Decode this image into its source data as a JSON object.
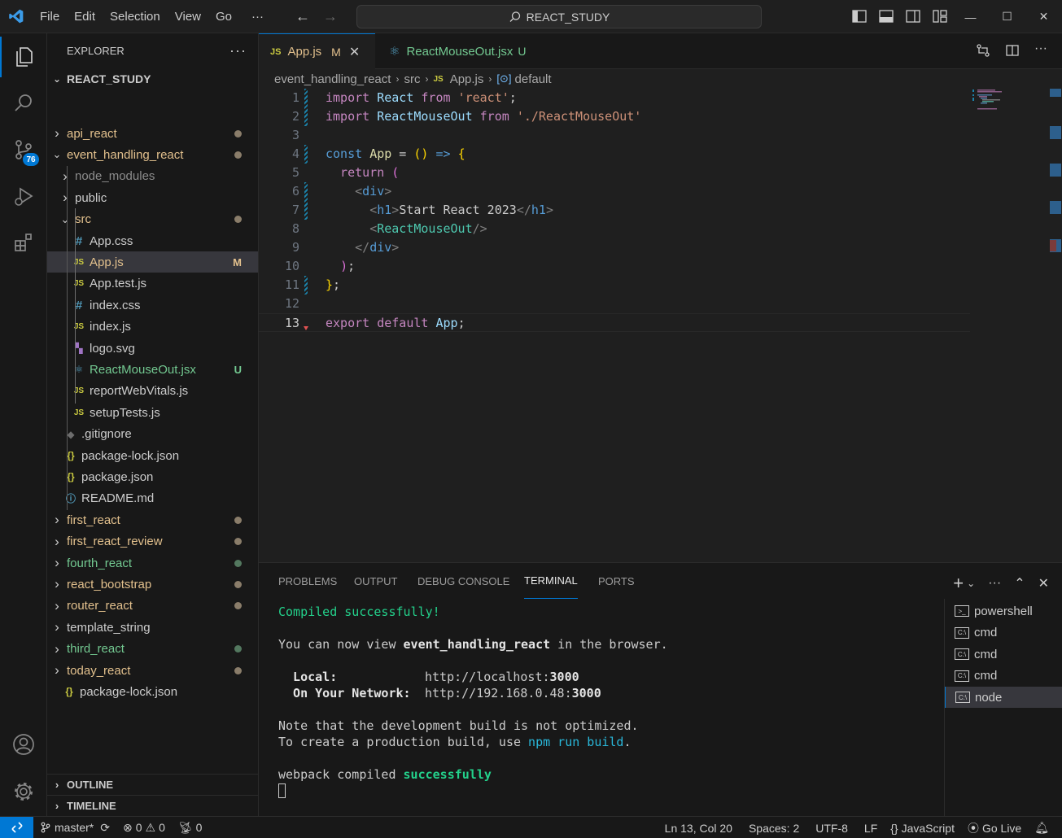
{
  "titlebar": {
    "menu": [
      "File",
      "Edit",
      "Selection",
      "View",
      "Go",
      "···"
    ],
    "search_text": "REACT_STUDY"
  },
  "activity": {
    "source_control_badge": "76"
  },
  "explorer": {
    "title": "EXPLORER",
    "more": "···",
    "root": "REACT_STUDY",
    "items": [
      {
        "label": "api_react",
        "icon": "",
        "status": "dot"
      },
      {
        "label": "event_handling_react",
        "icon": "",
        "status": "dot"
      },
      {
        "label": "node_modules",
        "icon": ""
      },
      {
        "label": "public",
        "icon": ""
      },
      {
        "label": "src",
        "icon": "",
        "status": "dot"
      },
      {
        "label": "App.css",
        "icon": "#"
      },
      {
        "label": "App.js",
        "icon": "JS",
        "status": "M"
      },
      {
        "label": "App.test.js",
        "icon": "JS"
      },
      {
        "label": "index.css",
        "icon": "#"
      },
      {
        "label": "index.js",
        "icon": "JS"
      },
      {
        "label": "logo.svg",
        "icon": "▚"
      },
      {
        "label": "ReactMouseOut.jsx",
        "icon": "⚛",
        "status": "U"
      },
      {
        "label": "reportWebVitals.js",
        "icon": "JS"
      },
      {
        "label": "setupTests.js",
        "icon": "JS"
      },
      {
        "label": ".gitignore",
        "icon": "◆"
      },
      {
        "label": "package-lock.json",
        "icon": "{}"
      },
      {
        "label": "package.json",
        "icon": "{}"
      },
      {
        "label": "README.md",
        "icon": "ⓘ"
      },
      {
        "label": "first_react",
        "icon": "",
        "status": "dot"
      },
      {
        "label": "first_react_review",
        "icon": "",
        "status": "dot"
      },
      {
        "label": "fourth_react",
        "icon": "",
        "status": "dot"
      },
      {
        "label": "react_bootstrap",
        "icon": "",
        "status": "dot"
      },
      {
        "label": "router_react",
        "icon": "",
        "status": "dot"
      },
      {
        "label": "template_string",
        "icon": ""
      },
      {
        "label": "third_react",
        "icon": "",
        "status": "dot"
      },
      {
        "label": "today_react",
        "icon": "",
        "status": "dot"
      },
      {
        "label": "package-lock.json",
        "icon": "{}"
      }
    ],
    "outline": "OUTLINE",
    "timeline": "TIMELINE"
  },
  "tabs": [
    {
      "icon": "JS",
      "label": "App.js",
      "status": "M",
      "close": "✕"
    },
    {
      "icon": "⚛",
      "label": "ReactMouseOut.jsx",
      "status": "U"
    }
  ],
  "breadcrumb": {
    "parts": [
      "event_handling_react",
      "src",
      "App.js",
      "default"
    ],
    "js_icon": "JS"
  },
  "code": {
    "line_numbers": [
      "1",
      "2",
      "3",
      "4",
      "5",
      "6",
      "7",
      "8",
      "9",
      "10",
      "11",
      "12",
      "13"
    ],
    "current_line": 13,
    "lines": [
      [
        [
          "import",
          "kw"
        ],
        [
          " ",
          ""
        ],
        [
          "React",
          "var"
        ],
        [
          " ",
          ""
        ],
        [
          "from",
          "kw"
        ],
        [
          " ",
          ""
        ],
        [
          "'react'",
          "str"
        ],
        [
          ";",
          "txt"
        ]
      ],
      [
        [
          "import",
          "kw"
        ],
        [
          " ",
          ""
        ],
        [
          "ReactMouseOut",
          "var"
        ],
        [
          " ",
          ""
        ],
        [
          "from",
          "kw"
        ],
        [
          " ",
          ""
        ],
        [
          "'./ReactMouseOut'",
          "str"
        ]
      ],
      [],
      [
        [
          "const",
          "kw2"
        ],
        [
          " ",
          ""
        ],
        [
          "App",
          "fn"
        ],
        [
          " = ",
          "txt"
        ],
        [
          "()",
          "p1"
        ],
        [
          " ",
          ""
        ],
        [
          "=>",
          "kw2"
        ],
        [
          " ",
          ""
        ],
        [
          "{",
          "p1"
        ]
      ],
      [
        [
          "  return",
          "kw"
        ],
        [
          " ",
          ""
        ],
        [
          "(",
          "p2"
        ]
      ],
      [
        [
          "    ",
          ""
        ],
        [
          "<",
          "tagp"
        ],
        [
          "div",
          "tag"
        ],
        [
          ">",
          "tagp"
        ]
      ],
      [
        [
          "      ",
          ""
        ],
        [
          "<",
          "tagp"
        ],
        [
          "h1",
          "tag"
        ],
        [
          ">",
          "tagp"
        ],
        [
          "Start React 2023",
          "txt"
        ],
        [
          "</",
          "tagp"
        ],
        [
          "h1",
          "tag"
        ],
        [
          ">",
          "tagp"
        ]
      ],
      [
        [
          "      ",
          ""
        ],
        [
          "<",
          "tagp"
        ],
        [
          "ReactMouseOut",
          "comp"
        ],
        [
          "/>",
          "tagp"
        ]
      ],
      [
        [
          "    ",
          ""
        ],
        [
          "</",
          "tagp"
        ],
        [
          "div",
          "tag"
        ],
        [
          ">",
          "tagp"
        ]
      ],
      [
        [
          "  ",
          ""
        ],
        [
          ")",
          "p2"
        ],
        [
          ";",
          "txt"
        ]
      ],
      [
        [
          "}",
          "p1"
        ],
        [
          ";",
          "txt"
        ]
      ],
      [],
      [
        [
          "export",
          "kw"
        ],
        [
          " ",
          ""
        ],
        [
          "default",
          "kw"
        ],
        [
          " ",
          ""
        ],
        [
          "App",
          "var"
        ],
        [
          ";",
          "txt"
        ]
      ]
    ]
  },
  "panel": {
    "tabs": [
      "PROBLEMS",
      "OUTPUT",
      "DEBUG CONSOLE",
      "TERMINAL",
      "PORTS"
    ],
    "active_tab": "TERMINAL",
    "terminal": {
      "l1": "Compiled successfully!",
      "l2a": "You can now view ",
      "l2b": "event_handling_react",
      "l2c": " in the browser.",
      "local_label": "  Local:",
      "local_url": "http://localhost:",
      "local_port": "3000",
      "net_label": "  On Your Network:",
      "net_url": "http://192.168.0.48:",
      "net_port": "3000",
      "note1": "Note that the development build is not optimized.",
      "note2a": "To create a production build, use ",
      "note2b": "npm run build",
      "note2c": ".",
      "webpack_a": "webpack compiled ",
      "webpack_b": "successfully"
    },
    "terminals": [
      "powershell",
      "cmd",
      "cmd",
      "cmd",
      "node"
    ]
  },
  "statusbar": {
    "branch": "master*",
    "errors": "0",
    "warnings": "0",
    "ports": "0",
    "position": "Ln 13, Col 20",
    "spaces": "Spaces: 2",
    "encoding": "UTF-8",
    "eol": "LF",
    "language": "JavaScript",
    "golive": "Go Live"
  }
}
